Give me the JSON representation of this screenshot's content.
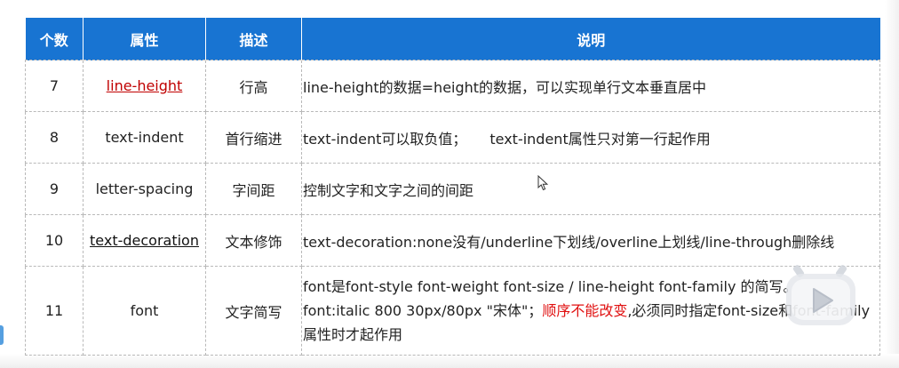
{
  "table": {
    "headers": [
      "个数",
      "属性",
      "描述",
      "说明"
    ],
    "rows": [
      {
        "num": "7",
        "prop": "line-height",
        "desc": "行高",
        "note": "line-height的数据=height的数据，可以实现单行文本垂直居中"
      },
      {
        "num": "8",
        "prop": "text-indent",
        "desc": "首行缩进",
        "note_a": "text-indent可以取负值；",
        "note_b": "text-indent属性只对第一行起作用"
      },
      {
        "num": "9",
        "prop": "letter-spacing",
        "desc": "字间距",
        "note": "控制文字和文字之间的间距"
      },
      {
        "num": "10",
        "prop": "text-decoration",
        "desc": "文本修饰",
        "note": "text-decoration:none没有/underline下划线/overline上划线/line-through删除线"
      },
      {
        "num": "11",
        "prop": "font",
        "desc": "文字简写",
        "note_line1": "font是font-style font-weight font-size / line-height font-family 的简写。",
        "note_line2_a": "font:italic  800 30px/80px \"宋体\"；",
        "note_line2_red": "顺序不能改变",
        "note_line2_b": ",必须同时指定font-size和font-family",
        "note_line3": "属性时才起作用"
      }
    ]
  },
  "colors": {
    "header_bg": "#1874d2",
    "header_text": "#ffffff",
    "link_red": "#c00000",
    "emphasis_red": "#e01010",
    "border": "#b9b9b9"
  },
  "icons": {
    "cursor": "mouse-pointer-icon",
    "play": "play-button-icon"
  }
}
